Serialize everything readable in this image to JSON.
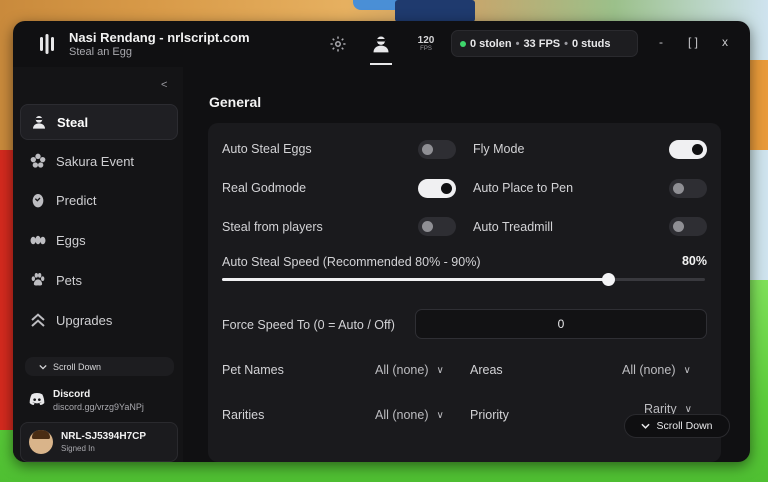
{
  "app": {
    "title": "Nasi Rendang - nrlscript.com",
    "subtitle": "Steal an Egg",
    "fps_badge_number": "120",
    "fps_badge_unit": "FPS"
  },
  "stats": {
    "stolen": "0 stolen",
    "fps": "33 FPS",
    "studs": "0 studs",
    "separator": "•"
  },
  "window_controls": {
    "minimize": "-",
    "maximize": "[ ]",
    "close": "x"
  },
  "sidebar": {
    "collapse": "<",
    "items": [
      {
        "label": "Steal",
        "icon": "user-icon"
      },
      {
        "label": "Sakura Event",
        "icon": "flower-icon"
      },
      {
        "label": "Predict",
        "icon": "egg-icon"
      },
      {
        "label": "Eggs",
        "icon": "eggs-icon"
      },
      {
        "label": "Pets",
        "icon": "paw-icon"
      },
      {
        "label": "Upgrades",
        "icon": "chevrons-up-icon"
      }
    ],
    "scroll_down": "Scroll Down",
    "discord_title": "Discord",
    "discord_link": "discord.gg/vrzg9YaNPj",
    "user_name": "NRL-SJ5394H7CP",
    "user_status": "Signed In"
  },
  "main": {
    "section_title": "General",
    "toggles": [
      {
        "label": "Auto Steal Eggs",
        "on": false
      },
      {
        "label": "Fly Mode",
        "on": true
      },
      {
        "label": "Real Godmode",
        "on": true
      },
      {
        "label": "Auto Place to Pen",
        "on": false
      },
      {
        "label": "Steal from players",
        "on": false
      },
      {
        "label": "Auto Treadmill",
        "on": false
      }
    ],
    "slider": {
      "label": "Auto Steal Speed (Recommended 80% - 90%)",
      "value": 80,
      "value_text": "80%"
    },
    "force_speed": {
      "label": "Force Speed To (0 = Auto / Off)",
      "value": "0"
    },
    "dropdowns": [
      {
        "label": "Pet Names",
        "value": "All (none)"
      },
      {
        "label": "Areas",
        "value": "All (none)"
      },
      {
        "label": "Rarities",
        "value": "All (none)"
      },
      {
        "label": "Priority",
        "value": "Rarity"
      }
    ],
    "scroll_down": "Scroll Down"
  }
}
